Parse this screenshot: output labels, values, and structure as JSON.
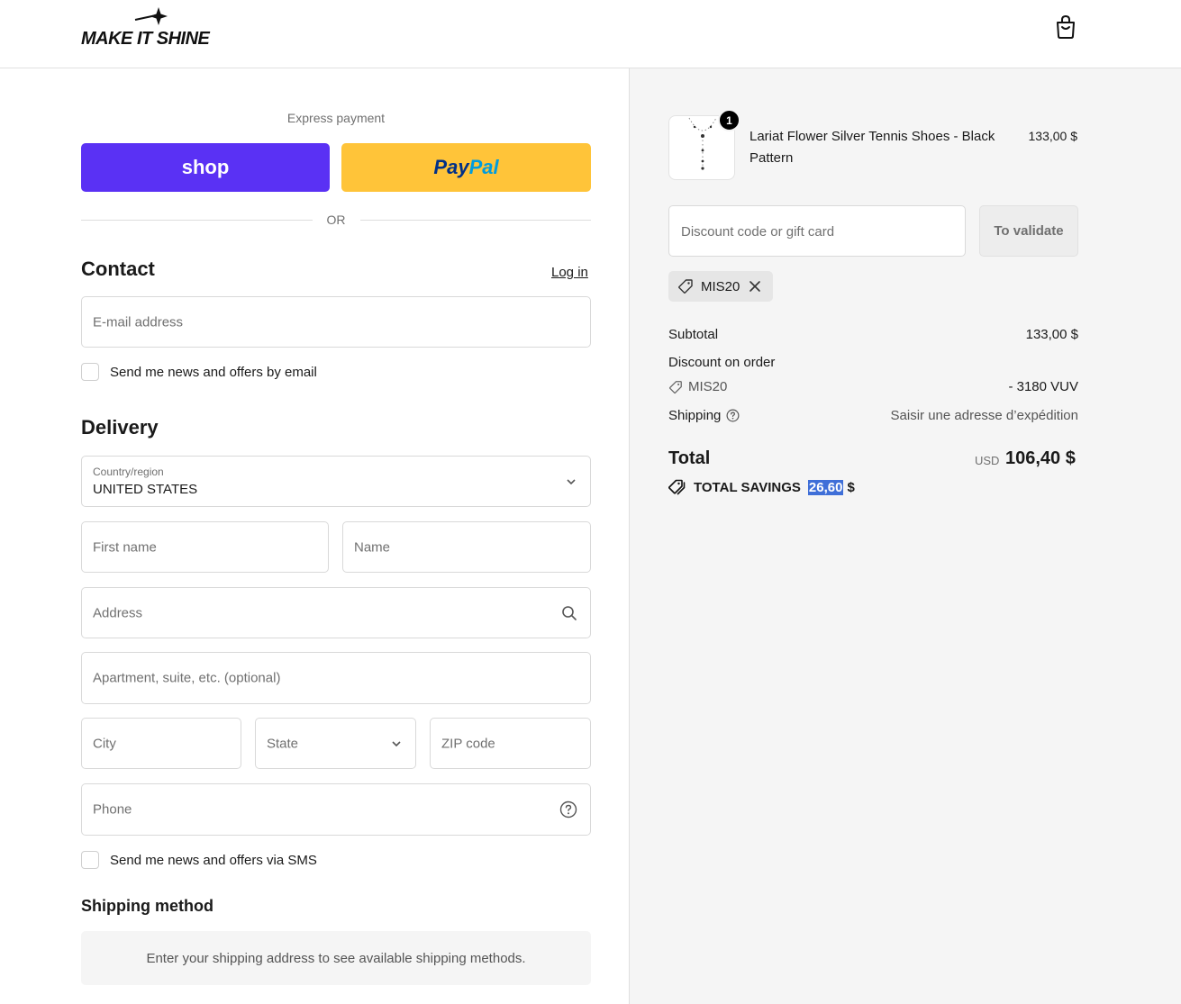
{
  "header": {
    "brand": "MAKE IT SHINE"
  },
  "express": {
    "label": "Express payment",
    "shop_label": "shop",
    "paypal_part1": "Pay",
    "paypal_part2": "Pal",
    "or_text": "OR"
  },
  "contact": {
    "title": "Contact",
    "login_label": "Log in",
    "email_placeholder": "E-mail address",
    "news_email_label": "Send me news and offers by email"
  },
  "delivery": {
    "title": "Delivery",
    "country_label": "Country/region",
    "country_value": "UNITED STATES",
    "first_name_placeholder": "First name",
    "name_placeholder": "Name",
    "address_placeholder": "Address",
    "apartment_placeholder": "Apartment, suite, etc. (optional)",
    "city_placeholder": "City",
    "state_placeholder": "State",
    "zip_placeholder": "ZIP code",
    "phone_placeholder": "Phone",
    "news_sms_label": "Send me news and offers via SMS"
  },
  "shipping_method": {
    "title": "Shipping method",
    "message": "Enter your shipping address to see available shipping methods."
  },
  "order": {
    "item": {
      "quantity": "1",
      "name": "Lariat Flower Silver Tennis Shoes - Black Pattern",
      "price": "133,00 $"
    },
    "discount_placeholder": "Discount code or gift card",
    "validate_label": "To validate",
    "applied_code": "MIS20",
    "subtotal_label": "Subtotal",
    "subtotal_value": "133,00 $",
    "discount_label": "Discount on order",
    "discount_code": "MIS20",
    "discount_value": "- 3180 VUV",
    "shipping_label": "Shipping",
    "shipping_value": "Saisir une adresse d’expédition",
    "total_label": "Total",
    "total_currency": "USD",
    "total_value": "106,40 $",
    "savings_label": "TOTAL SAVINGS",
    "savings_amount": "26,60",
    "savings_currency": "$"
  },
  "colors": {
    "shop_brand": "#5a31f4",
    "paypal_brand": "#ffc439",
    "paypal_dark": "#003087",
    "paypal_light": "#009cde",
    "highlight": "#3f6fd8"
  }
}
